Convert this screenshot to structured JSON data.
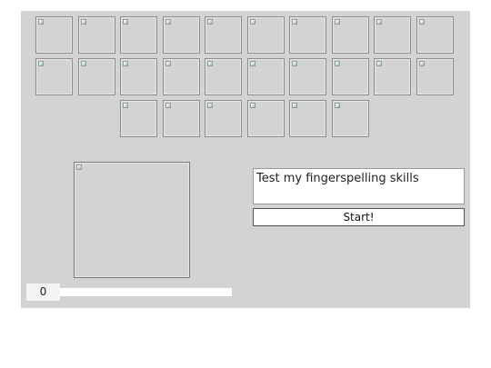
{
  "letter_grid": {
    "tile_count": 26,
    "icon": "broken-image-icon"
  },
  "preview": {
    "icon": "broken-image-icon"
  },
  "prompt": {
    "text": "Test my fingerspelling skills"
  },
  "start_button": {
    "label": "Start!"
  },
  "score": {
    "value": "0"
  },
  "progress": {
    "fraction": 0
  },
  "colors": {
    "panel": "#d3d3d3",
    "progress_fill": "#4a8f3c"
  }
}
